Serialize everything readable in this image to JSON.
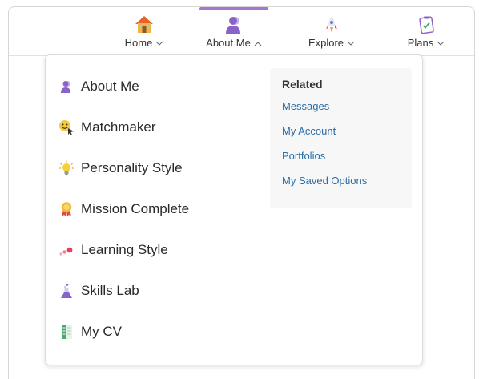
{
  "nav": {
    "items": [
      {
        "label": "Home",
        "icon": "house-icon"
      },
      {
        "label": "About Me",
        "icon": "person-icon"
      },
      {
        "label": "Explore",
        "icon": "rocket-icon"
      },
      {
        "label": "Plans",
        "icon": "checklist-icon"
      }
    ],
    "active": "About Me"
  },
  "menu": {
    "items": [
      {
        "label": "About Me",
        "icon": "person-icon"
      },
      {
        "label": "Matchmaker",
        "icon": "smiley-cursor-icon"
      },
      {
        "label": "Personality Style",
        "icon": "lightbulb-icon"
      },
      {
        "label": "Mission Complete",
        "icon": "award-ribbon-icon"
      },
      {
        "label": "Learning Style",
        "icon": "dots-icon"
      },
      {
        "label": "Skills Lab",
        "icon": "flask-icon"
      },
      {
        "label": "My CV",
        "icon": "document-icon"
      }
    ]
  },
  "related": {
    "title": "Related",
    "links": [
      "Messages",
      "My Account",
      "Portfolios",
      "My Saved Options"
    ]
  },
  "colors": {
    "accent": "#a874d6",
    "link": "#2a6ea8"
  }
}
